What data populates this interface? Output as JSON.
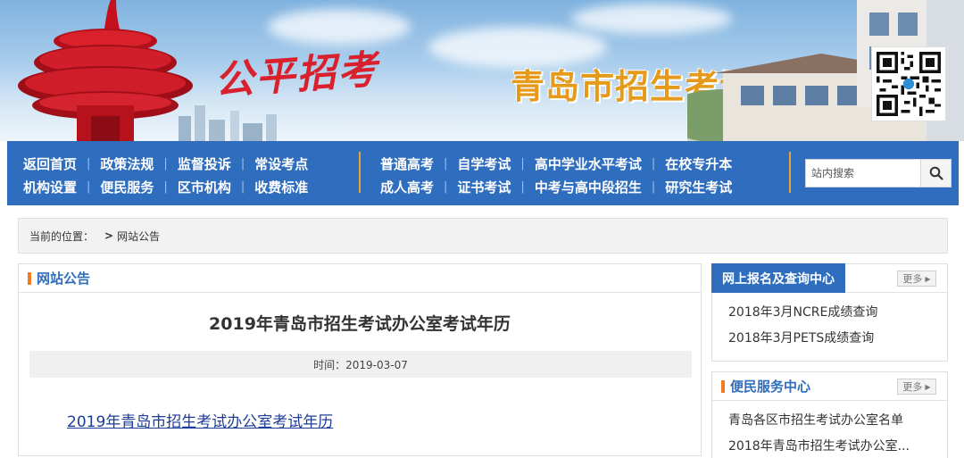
{
  "banner": {
    "script_title": "公平招考",
    "site_title": "青岛市招生考试办公室"
  },
  "nav": {
    "group1": {
      "row1": [
        "返回首页",
        "政策法规",
        "监督投诉",
        "常设考点"
      ],
      "row2": [
        "机构设置",
        "便民服务",
        "区市机构",
        "收费标准"
      ]
    },
    "group2": {
      "row1": [
        "普通高考",
        "自学考试",
        "高中学业水平考试",
        "在校专升本"
      ],
      "row2": [
        "成人高考",
        "证书考试",
        "中考与高中段招生",
        "研究生考试"
      ]
    },
    "search": {
      "placeholder": "站内搜索"
    }
  },
  "breadcrumb": {
    "label": "当前的位置：",
    "arrow": ">",
    "current": "网站公告"
  },
  "main": {
    "section_title": "网站公告",
    "article_title": "2019年青岛市招生考试办公室考试年历",
    "article_time": "时间：2019-03-07",
    "article_link": "2019年青岛市招生考试办公室考试年历"
  },
  "side1": {
    "title": "网上报名及查询中心",
    "more": "更多",
    "items": [
      "2018年3月NCRE成绩查询",
      "2018年3月PETS成绩查询"
    ]
  },
  "side2": {
    "title": "便民服务中心",
    "more": "更多",
    "items": [
      "青岛各区市招生考试办公室名单",
      "2018年青岛市招生考试办公室..."
    ]
  },
  "colors": {
    "nav_bg": "#2f6dbf",
    "accent_orange": "#f07b20",
    "title_gold": "#e69a1c",
    "script_red": "#d8212c",
    "link_blue": "#1d3c97"
  }
}
